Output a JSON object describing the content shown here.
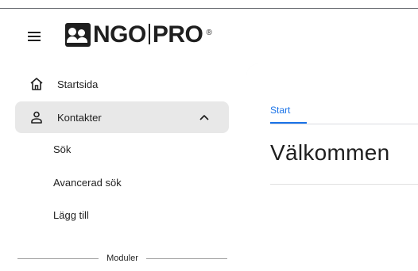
{
  "brand": {
    "logo_text_left": "NGO",
    "logo_text_right": "PRO",
    "registered_mark": "®"
  },
  "sidebar": {
    "items": [
      {
        "label": "Startsida",
        "icon": "home-icon",
        "active": false
      },
      {
        "label": "Kontakter",
        "icon": "person-icon",
        "active": true,
        "expanded": true,
        "children": [
          {
            "label": "Sök"
          },
          {
            "label": "Avancerad sök"
          },
          {
            "label": "Lägg till"
          }
        ]
      }
    ],
    "section_divider": "Moduler"
  },
  "main": {
    "tabs": [
      {
        "label": "Start",
        "active": true
      }
    ],
    "title": "Välkommen"
  },
  "colors": {
    "accent": "#1a73e8",
    "active_nav_bg": "#e8e8e8",
    "text": "#1f1f1f"
  }
}
